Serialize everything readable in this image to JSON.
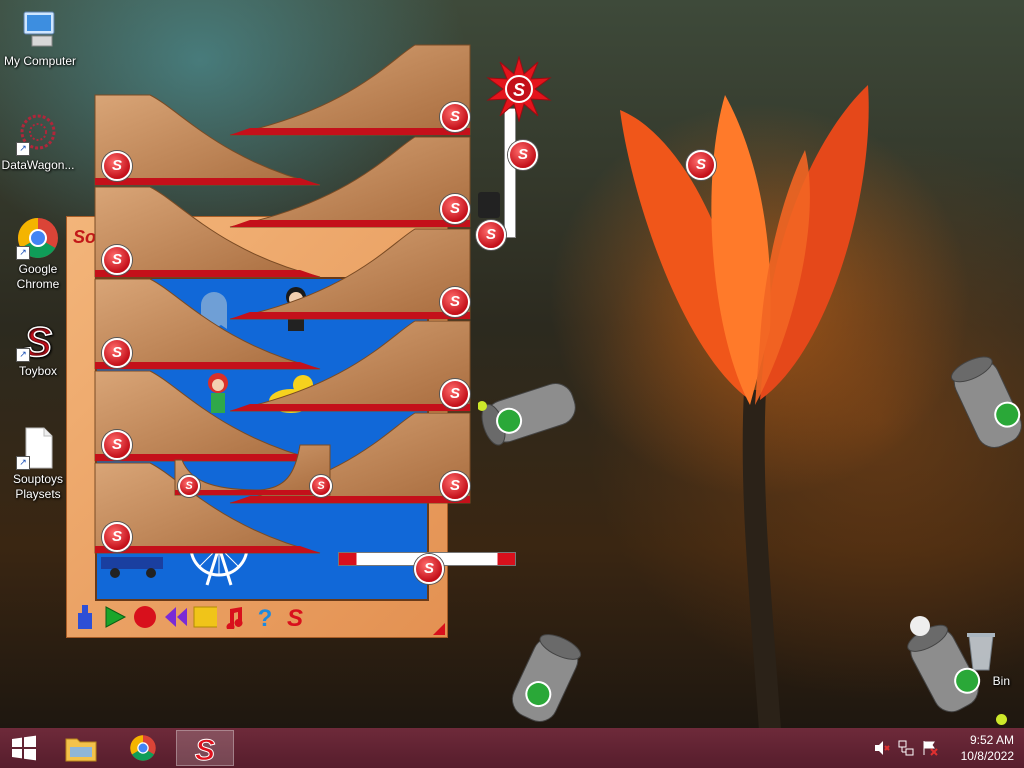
{
  "desktop_icons": [
    {
      "label": "My Computer",
      "icon": "computer-icon"
    },
    {
      "label": "DataWagon...",
      "icon": "datawagon-icon"
    },
    {
      "label": "Google Chrome",
      "icon": "chrome-icon"
    },
    {
      "label": "Toybox",
      "icon": "soup-s-icon"
    },
    {
      "label": "Souptoys Playsets",
      "icon": "document-icon"
    },
    {
      "label": "Bin",
      "icon": "recycle-bin-icon"
    }
  ],
  "toybox_window": {
    "title": "So T"
  },
  "toolbar": [
    "blue-figure-icon",
    "play-icon",
    "record-icon",
    "rewind-icon",
    "stop-icon",
    "music-icon",
    "help-icon",
    "soup-s-icon"
  ],
  "taskbar": {
    "items": [
      "start-button",
      "file-explorer",
      "google-chrome",
      "souptoys"
    ],
    "time": "9:52 AM",
    "date": "10/8/2022"
  },
  "colors": {
    "taskbar": "#5e2131",
    "wood": "#c4875a",
    "accent_red": "#c4101a",
    "stage_blue": "#1168d8"
  },
  "badge_letter": "S"
}
